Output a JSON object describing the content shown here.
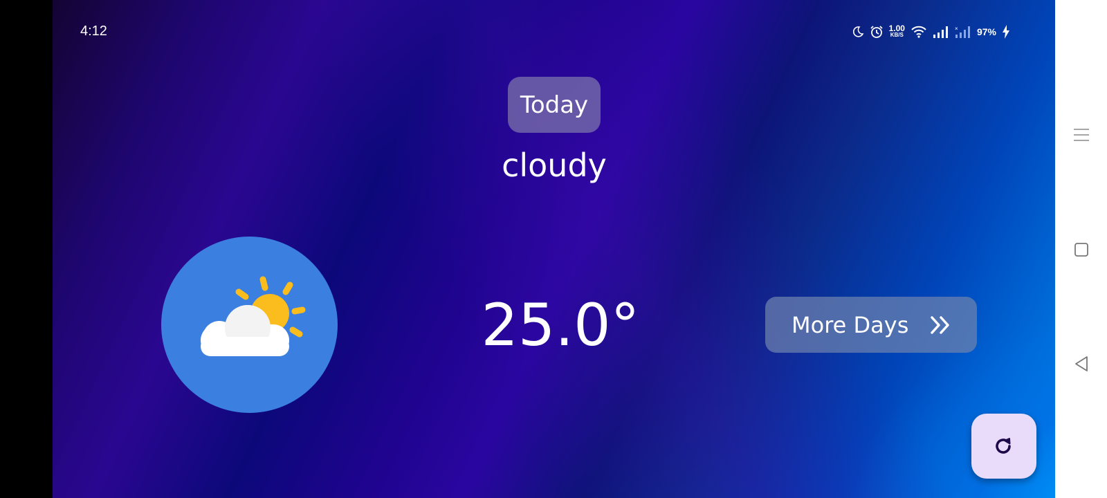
{
  "status_bar": {
    "time": "4:12",
    "net_speed_value": "1.00",
    "net_speed_unit": "KB/S",
    "battery": "97%",
    "icons": [
      "moon-icon",
      "alarm-icon",
      "wifi-icon",
      "signal-icon",
      "signal-no-sim-icon",
      "charging-icon"
    ]
  },
  "weather": {
    "day_label": "Today",
    "condition": "cloudy",
    "temperature": "25.0°",
    "icon": "partly-cloudy-icon"
  },
  "actions": {
    "more_days_label": "More Days",
    "more_days_icon": "double-chevron-right-icon",
    "refresh_icon": "refresh-icon"
  },
  "navigation": {
    "buttons": [
      "menu-icon",
      "home-square-icon",
      "back-triangle-icon"
    ]
  },
  "colors": {
    "icon_circle": "#3b7fe0",
    "fab_background": "#e9dcfb",
    "fab_icon": "#1e0a4a",
    "sun": "#fbbd1d"
  }
}
